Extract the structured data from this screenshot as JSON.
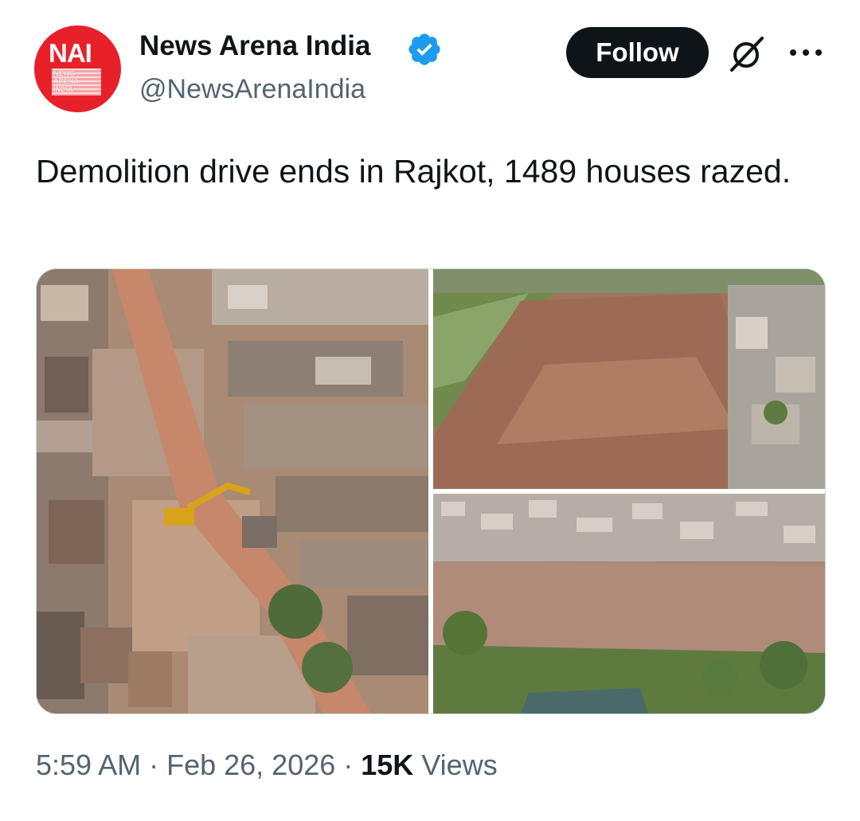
{
  "author": {
    "avatar_text": "NAI",
    "avatar_subtext": "NEWS ARENA INDIA",
    "display_name": "News Arena India",
    "handle": "@NewsArenaIndia",
    "verified": true
  },
  "actions": {
    "follow_label": "Follow",
    "grok_icon": "grok-icon",
    "more_icon": "more-icon"
  },
  "tweet": {
    "text": "Demolition drive ends in Rajkot, 1489 houses razed."
  },
  "media": {
    "photos": [
      {
        "name": "aerial-demolition-street"
      },
      {
        "name": "aerial-cleared-area-riverbank"
      },
      {
        "name": "aerial-cleared-area-settlement"
      }
    ]
  },
  "meta": {
    "time": "5:59 AM",
    "sep1": " · ",
    "date": "Feb 26, 2026",
    "sep2": " · ",
    "views_count": "15K",
    "views_label": " Views"
  },
  "colors": {
    "brand_red": "#e8202a",
    "verified_blue": "#1d9bf0",
    "text": "#0f1419",
    "secondary": "#536471"
  }
}
